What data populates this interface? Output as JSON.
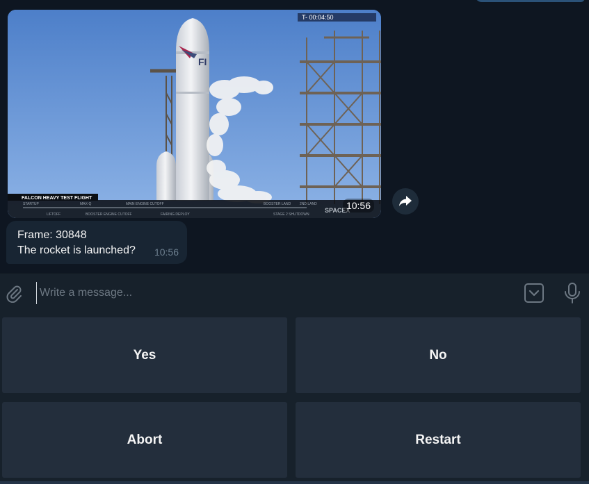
{
  "chat": {
    "photo_message": {
      "time": "10:56",
      "overlay": {
        "banner": "FALCON HEAVY TEST FLIGHT",
        "timer": "T-  00:04:50",
        "logo_fragment": "FI",
        "brand_watermark": "SPACEX",
        "timeline_top_labels": [
          "STARTUP",
          "MAX-Q",
          "MAIN ENGINE CUTOFF",
          "BOOSTER LAND",
          "2ND LAND"
        ],
        "timeline_bottom_labels": [
          "LIFTOFF",
          "BOOSTER ENGINE CUTOFF",
          "FAIRING DEPLOY",
          "STAGE 2 SHUTDOWN"
        ]
      }
    },
    "forward_icon": "forward-arrow-icon",
    "text_message": {
      "line1": "Frame: 30848",
      "line2": "The rocket is launched?",
      "time": "10:56"
    }
  },
  "composer": {
    "placeholder": "Write a message...",
    "value": "",
    "icons": [
      "paperclip-icon",
      "bot-keyboard-icon",
      "microphone-icon"
    ]
  },
  "bot_keyboard": {
    "yes_label": "Yes",
    "no_label": "No",
    "abort_label": "Abort",
    "restart_label": "Restart"
  },
  "colors": {
    "background": "#0e1621",
    "incoming_bubble": "#182533",
    "outgoing_bubble": "#2b5278",
    "panel": "#17212b",
    "button": "#232e3c",
    "text": "#f5f5f5",
    "muted": "#6d7f8f"
  }
}
